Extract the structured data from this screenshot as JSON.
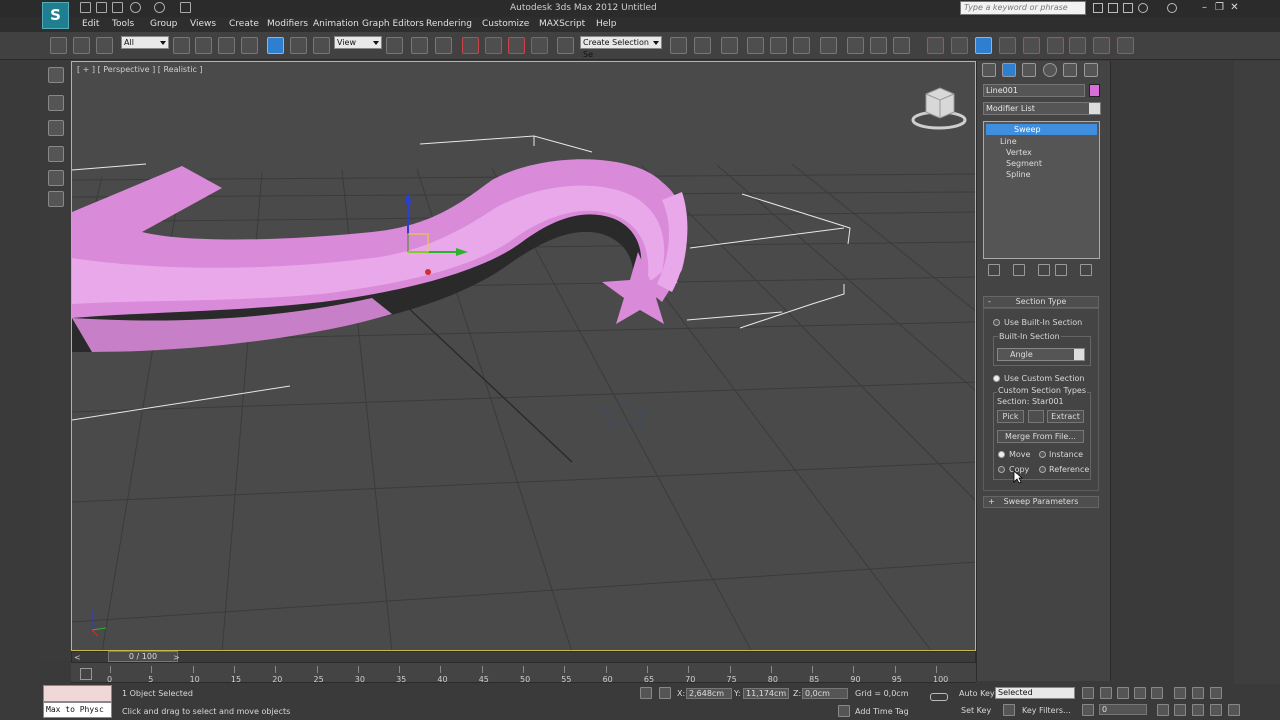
{
  "titlebar": {
    "app_logo": "S",
    "title": "Autodesk 3ds Max 2012     Untitled",
    "search_placeholder": "Type a keyword or phrase"
  },
  "menu": [
    "Edit",
    "Tools",
    "Group",
    "Views",
    "Create",
    "Modifiers",
    "Animation",
    "Graph Editors",
    "Rendering",
    "Customize",
    "MAXScript",
    "Help"
  ],
  "toolbar": {
    "selection_filter": "All",
    "reference_coord": "View",
    "named_selection": "Create Selection Se"
  },
  "viewport": {
    "label": "[ + ] [ Perspective ] [ Realistic ]",
    "object_color": "#d98ad9"
  },
  "command_panel": {
    "object_name": "Line001",
    "object_color": "#d86ed8",
    "modifier_list": "Modifier List",
    "stack": {
      "sweep": "Sweep",
      "line": "Line",
      "vertex": "Vertex",
      "segment": "Segment",
      "spline": "Spline"
    },
    "section_type": {
      "title": "Section Type",
      "use_builtin": "Use Built-In Section",
      "builtin_group": "Built-In Section",
      "builtin_value": "Angle",
      "use_custom": "Use Custom Section",
      "custom_group": "Custom Section Types",
      "section_name": "Section: Star001",
      "pick": "Pick",
      "extract": "Extract",
      "merge": "Merge From File...",
      "move": "Move",
      "instance": "Instance",
      "copy": "Copy",
      "reference": "Reference"
    },
    "sweep_parameters": "Sweep Parameters"
  },
  "timeline": {
    "slider": "0 / 100",
    "ticks": [
      "0",
      "5",
      "10",
      "15",
      "20",
      "25",
      "30",
      "35",
      "40",
      "45",
      "50",
      "55",
      "60",
      "65",
      "70",
      "75",
      "80",
      "85",
      "90",
      "95",
      "100"
    ]
  },
  "status": {
    "maxscript_command": "Max to Physc",
    "objects_selected": "1 Object Selected",
    "prompt": "Click and drag to select and move objects",
    "x_label": "X:",
    "x_value": "2,648cm",
    "y_label": "Y:",
    "y_value": "11,174cm",
    "z_label": "Z:",
    "z_value": "0,0cm",
    "grid": "Grid = 0,0cm",
    "add_time_tag": "Add Time Tag",
    "auto_key": "Auto Key",
    "set_key": "Set Key",
    "key_mode": "Selected",
    "key_filters": "Key Filters...",
    "frame": "0"
  }
}
